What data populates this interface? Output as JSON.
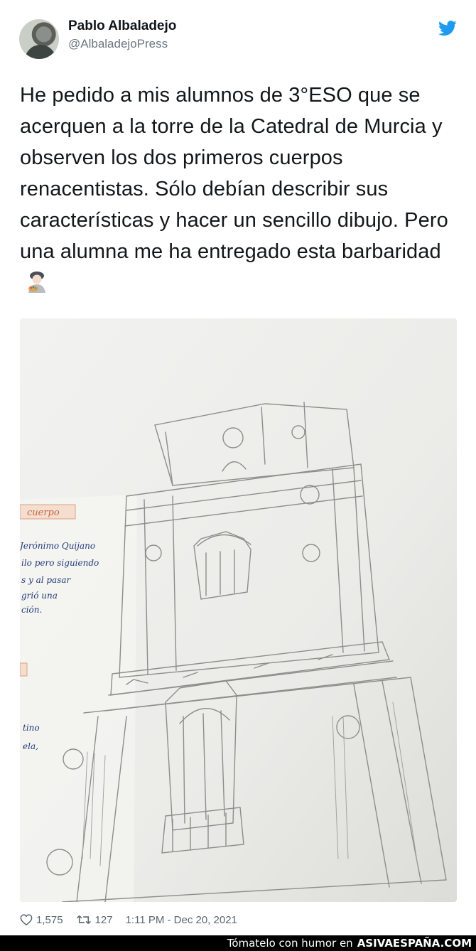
{
  "author": {
    "name": "Pablo Albaladejo",
    "handle": "@AlbaladejoPress"
  },
  "tweet": {
    "text": "He pedido a mis alumnos de 3°ESO que se acerquen a la torre de la Catedral de Murcia y observen los dos primeros cuerpos renacentistas. Sólo debían describir sus características y hacer un sencillo dibujo. Pero una alumna me ha entregado esta barbaridad",
    "emoji": "woman-artist-emoji"
  },
  "photo": {
    "note_tag": "cuerpo",
    "note_lines": [
      "Jerónimo Quijano",
      "ilo pero siguiendo",
      "s y al pasar",
      "grió una",
      "ción."
    ],
    "note_lines_2": [
      "tino",
      "ela,"
    ]
  },
  "stats": {
    "likes": "1,575",
    "retweets": "127",
    "timestamp": "1:11 PM - Dec 20, 2021"
  },
  "watermark": {
    "prefix": "Tómatelo con humor en",
    "site": "ASIVAESPAÑA.COM"
  },
  "icons": {
    "brand": "twitter-bird-icon",
    "like": "heart-icon",
    "retweet": "retweet-icon"
  },
  "colors": {
    "twitter_blue": "#1d9bf0",
    "muted_text": "#5b6770",
    "paper": "#efefed",
    "pencil": "#8d8d8a"
  }
}
